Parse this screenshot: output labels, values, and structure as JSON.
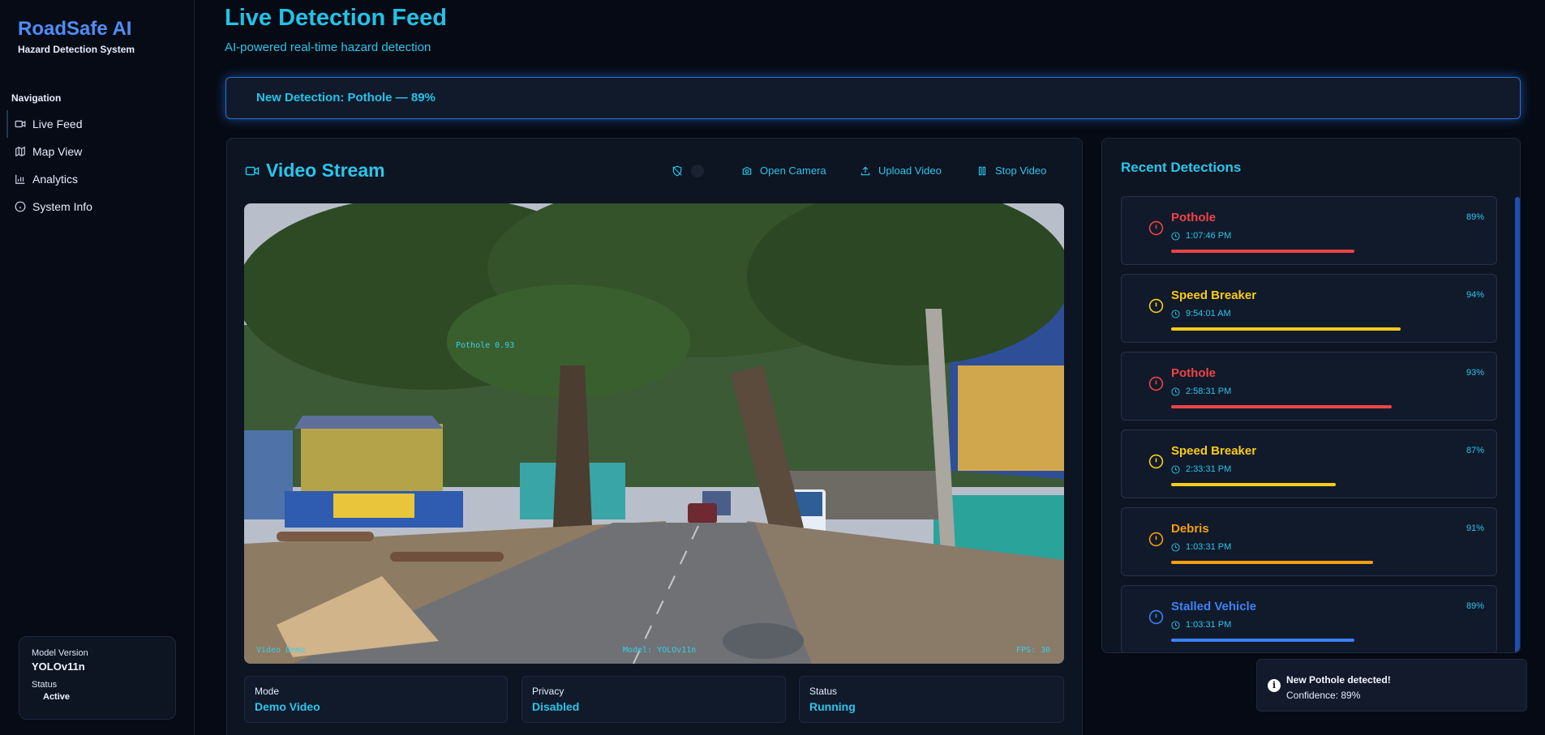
{
  "brand": {
    "title": "RoadSafe AI",
    "subtitle": "Hazard Detection System"
  },
  "nav": {
    "heading": "Navigation",
    "items": [
      {
        "label": "Live Feed",
        "icon": "video-icon",
        "active": true
      },
      {
        "label": "Map View",
        "icon": "map-icon"
      },
      {
        "label": "Analytics",
        "icon": "bar-chart-icon"
      },
      {
        "label": "System Info",
        "icon": "info-icon"
      }
    ]
  },
  "model": {
    "version_label": "Model Version",
    "version_value": "YOLOv11n",
    "status_label": "Status",
    "status_value": "Active"
  },
  "header": {
    "title": "Live Detection Feed",
    "subtitle": "AI-powered real-time hazard detection"
  },
  "alert": {
    "text": "New Detection: Pothole — 89%"
  },
  "video": {
    "title": "Video Stream",
    "buttons": {
      "open_camera": "Open Camera",
      "upload_video": "Upload Video",
      "stop_video": "Stop Video"
    },
    "overlay": {
      "detection_label": "Pothole 0.93",
      "source": "Video Demo",
      "model": "Model: YOLOv11n",
      "fps": "FPS: 30"
    },
    "info": [
      {
        "label": "Mode",
        "value": "Demo Video"
      },
      {
        "label": "Privacy",
        "value": "Disabled"
      },
      {
        "label": "Status",
        "value": "Running"
      }
    ]
  },
  "recent": {
    "title": "Recent Detections",
    "items": [
      {
        "name": "Pothole",
        "time": "1:07:46 PM",
        "confidence": "89%",
        "conf_value": 0.89,
        "color": "#ef4444"
      },
      {
        "name": "Speed Breaker",
        "time": "9:54:01 AM",
        "confidence": "94%",
        "conf_value": 0.94,
        "color": "#facc15"
      },
      {
        "name": "Pothole",
        "time": "2:58:31 PM",
        "confidence": "93%",
        "conf_value": 0.93,
        "color": "#ef4444"
      },
      {
        "name": "Speed Breaker",
        "time": "2:33:31 PM",
        "confidence": "87%",
        "conf_value": 0.87,
        "color": "#facc15"
      },
      {
        "name": "Debris",
        "time": "1:03:31 PM",
        "confidence": "91%",
        "conf_value": 0.91,
        "color": "#f59e0b"
      },
      {
        "name": "Stalled Vehicle",
        "time": "1:03:31 PM",
        "confidence": "89%",
        "conf_value": 0.89,
        "color": "#3b82f6"
      }
    ]
  },
  "toast": {
    "title": "New Pothole detected!",
    "body": "Confidence: 89%"
  }
}
